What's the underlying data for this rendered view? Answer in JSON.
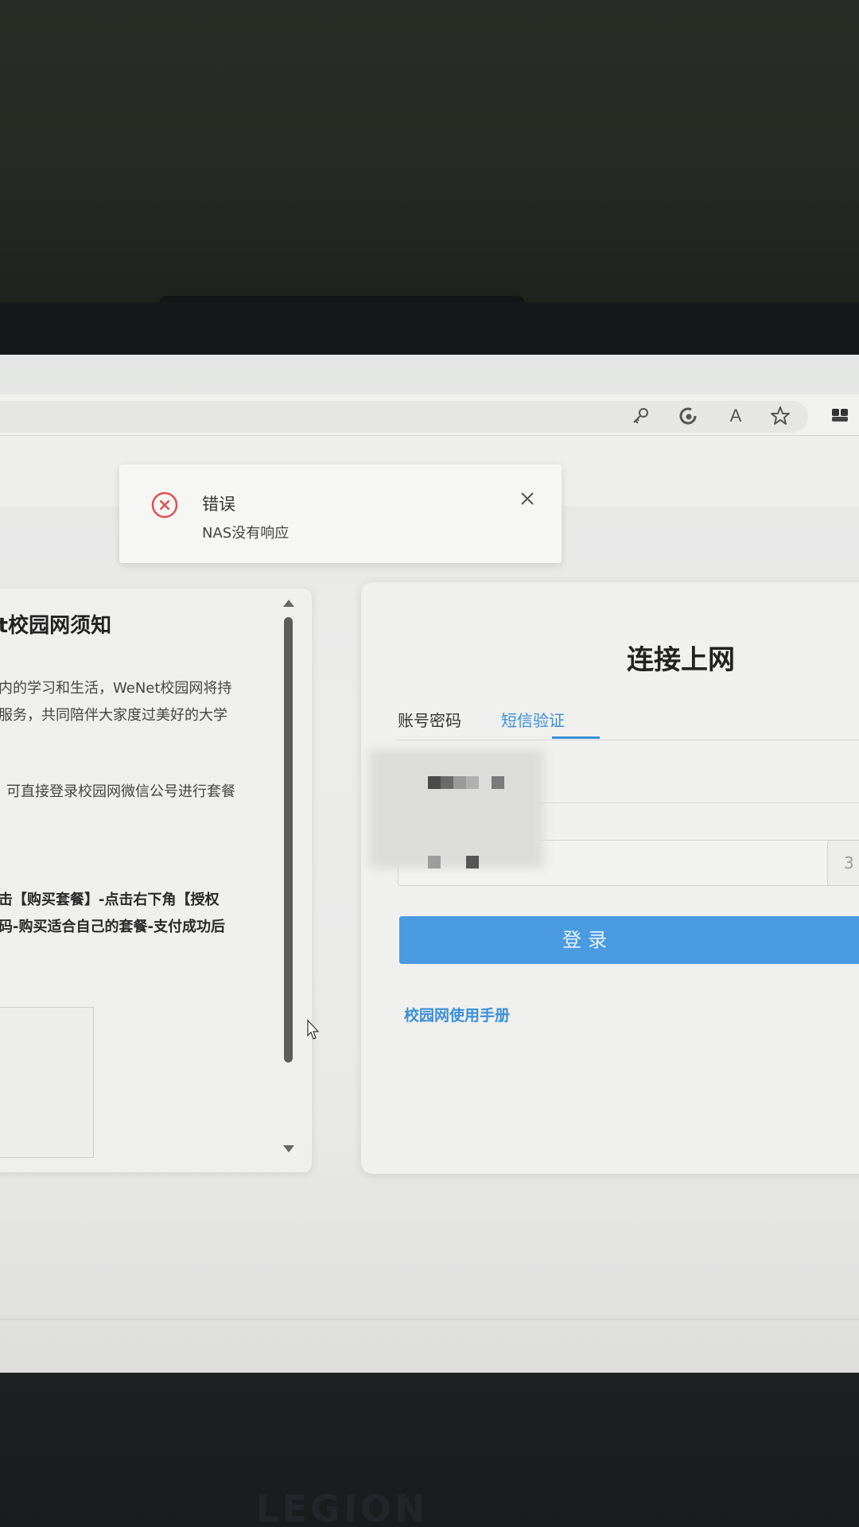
{
  "toast": {
    "title": "错误",
    "message": "NAS没有响应",
    "icon": "error-circle-icon",
    "close_icon": "close-icon"
  },
  "browser": {
    "toolbar_icons": [
      "key-icon",
      "edge-refresh-icon",
      "read-aloud-icon",
      "star-icon",
      "extensions-icon"
    ],
    "read_aloud_glyph": "A"
  },
  "notice": {
    "title": "et校园网须知",
    "paragraphs": [
      "校内的学习和生活，WeNet校园网将持",
      "入服务，共同陪伴大家度过美好的大学",
      "，可直接登录校园网微信公号进行套餐"
    ],
    "steps": [
      "点击【购买套餐】-点击右下角【授权",
      "密码-购买适合自己的套餐-支付成功后"
    ]
  },
  "login": {
    "title": "连接上网",
    "tabs": [
      {
        "label": "账号密码",
        "active": false
      },
      {
        "label": "短信验证",
        "active": true
      }
    ],
    "code_button_label": "3",
    "submit_label": "登录",
    "manual_link": "校园网使用手册",
    "accent_color": "#3b8fd8"
  },
  "brand_text": "LEGION"
}
